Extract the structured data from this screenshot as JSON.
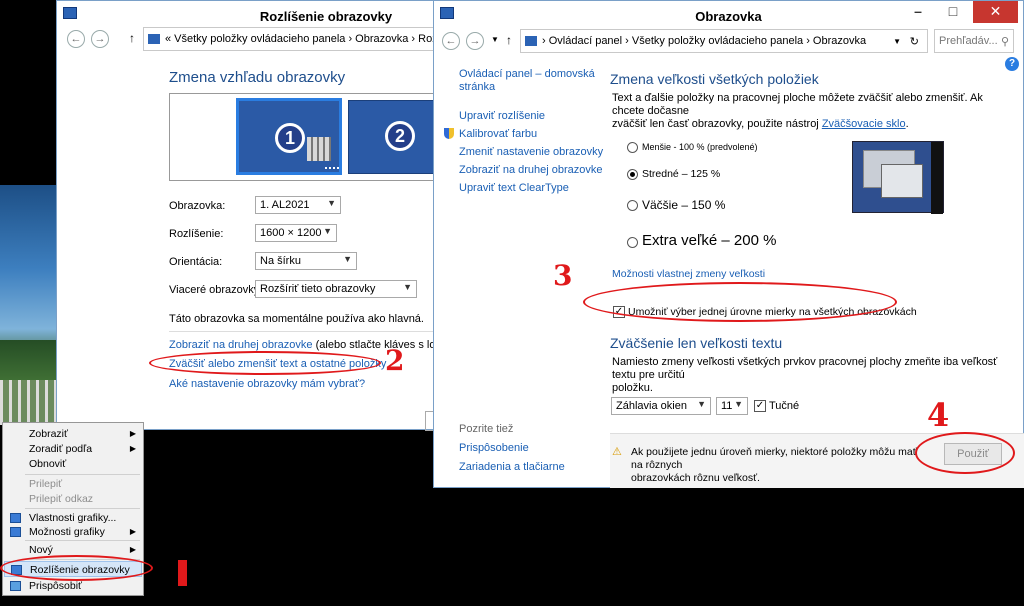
{
  "win1": {
    "title": "Rozlíšenie obrazovky",
    "address": "«  Všetky položky ovládacieho panela  ›  Obrazovka  ›  Rozlíš",
    "heading": "Zmena vzhľadu obrazovky",
    "monitor1": "1",
    "monitor2": "2",
    "fields": {
      "display_label": "Obrazovka:",
      "display_value": "1. AL2021",
      "resolution_label": "Rozlíšenie:",
      "resolution_value": "1600 × 1200",
      "orientation_label": "Orientácia:",
      "orientation_value": "Na šírku",
      "multi_label": "Viaceré obrazovky:",
      "multi_value": "Rozšíriť tieto obrazovky"
    },
    "main_note": "Táto obrazovka sa momentálne používa ako hlavná.",
    "link_second": "Zobraziť na druhej obrazovke",
    "link_second_suffix": " (alebo stlačte kláves s logom sys",
    "link_scale": "Zväčšiť alebo zmenšiť text a ostatné položky",
    "link_which": "Aké nastavenie obrazovky mám vybrať?"
  },
  "win2": {
    "title": "Obrazovka",
    "address_parts": [
      "Ovládací panel",
      "Všetky položky ovládacieho panela",
      "Obrazovka"
    ],
    "search_placeholder": "Prehľadáv...",
    "help": "?",
    "sidebar": {
      "home_line1": "Ovládací panel – domovská",
      "home_line2": "stránka",
      "items": [
        "Upraviť rozlíšenie",
        "Kalibrovať farbu",
        "Zmeniť nastavenie obrazovky",
        "Zobraziť na druhej obrazovke",
        "Upraviť text ClearType"
      ],
      "see_also": "Pozrite tiež",
      "see_items": [
        "Prispôsobenie",
        "Zariadenia a tlačiarne"
      ]
    },
    "heading1": "Zmena veľkosti všetkých položiek",
    "desc1_line1": "Text a ďalšie položky na pracovnej ploche môžete zväčšiť alebo zmenšiť. Ak chcete dočasne",
    "desc1_line2": "zväčšiť len časť obrazovky, použite nástroj ",
    "desc1_link": "Zväčšovacie sklo",
    "desc1_end": ".",
    "options": [
      "Menšie - 100 % (predvolené)",
      "Stredné – 125 %",
      "Väčšie – 150 %",
      "Extra veľké – 200 %"
    ],
    "custom_link": "Možnosti vlastnej zmeny veľkosti",
    "checkbox_label": "Umožniť výber jednej úrovne mierky na všetkých obrazovkách",
    "heading2": "Zväčšenie len veľkosti textu",
    "desc2_line1": "Namiesto zmeny veľkosti všetkých prvkov pracovnej plochy zmeňte iba veľkosť textu pre určitú",
    "desc2_line2": "položku.",
    "element_select": "Záhlavia okien",
    "size_select": "11",
    "bold_label": "Tučné",
    "warning_line1": "Ak použijete jednu úroveň mierky, niektoré položky môžu mať na rôznych",
    "warning_line2": "obrazovkách rôznu veľkosť.",
    "apply_button": "Použiť"
  },
  "context_menu": {
    "items": [
      {
        "label": "Zobraziť",
        "submenu": true
      },
      {
        "label": "Zoradiť podľa",
        "submenu": true
      },
      {
        "label": "Obnoviť"
      },
      {
        "label": "Prilepiť",
        "disabled": true
      },
      {
        "label": "Prilepiť odkaz",
        "disabled": true
      },
      {
        "label": "Vlastnosti grafiky...",
        "icon": "graphics-icon"
      },
      {
        "label": "Možnosti grafiky",
        "icon": "graphics-icon",
        "submenu": true
      },
      {
        "label": "Nový",
        "submenu": true
      },
      {
        "label": "Rozlíšenie obrazovky",
        "icon": "display-icon",
        "highlighted": true
      },
      {
        "label": "Prispôsobiť",
        "icon": "personalize-icon"
      }
    ]
  },
  "annotations": [
    "1",
    "2",
    "3",
    "4"
  ],
  "colors": {
    "annotation_red": "#e0191b",
    "link_blue": "#1a5fb4",
    "heading_blue": "#1e4e8c"
  }
}
